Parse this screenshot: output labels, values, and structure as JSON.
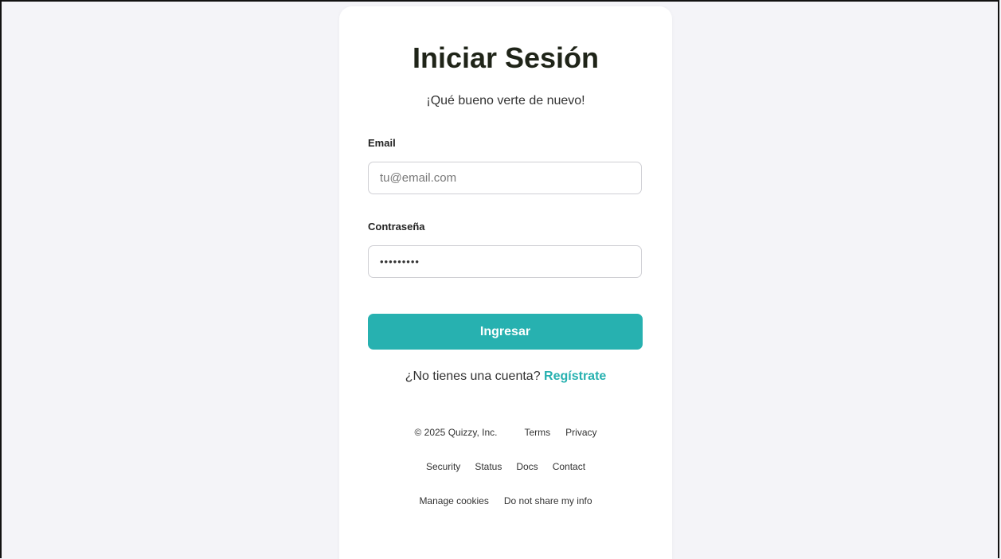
{
  "login": {
    "title": "Iniciar Sesión",
    "subtitle": "¡Qué bueno verte de nuevo!",
    "email_label": "Email",
    "email_placeholder": "tu@email.com",
    "password_label": "Contraseña",
    "password_value": "•••••••••",
    "submit_label": "Ingresar",
    "register_prompt": "¿No tienes una cuenta?",
    "register_link": "Regístrate"
  },
  "footer": {
    "copyright": "© 2025 Quizzy, Inc.",
    "links_row1": [
      "Terms",
      "Privacy"
    ],
    "links_row2": [
      "Security",
      "Status",
      "Docs",
      "Contact"
    ],
    "links_row3": [
      "Manage cookies",
      "Do not share my info"
    ]
  },
  "colors": {
    "accent": "#27b1b0",
    "background": "#f4f4f8",
    "card": "#ffffff"
  }
}
